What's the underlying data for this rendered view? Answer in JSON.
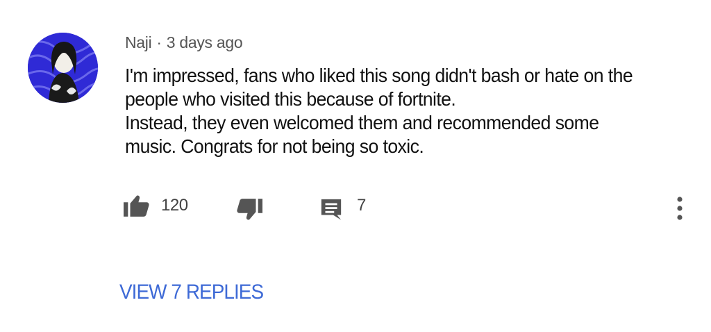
{
  "comment": {
    "author": "Naji",
    "separator": "·",
    "time": "3 days ago",
    "text_lines": [
      "I'm impressed, fans who liked this song didn't bash or hate on the",
      "people who visited this because of fortnite.",
      "Instead, they even welcomed them and recommended some",
      "music. Congrats for not being so toxic."
    ],
    "likes": "120",
    "replies_count": "7",
    "view_replies_label": "VIEW 7 REPLIES"
  },
  "icons": {
    "avatar": "user-avatar",
    "like": "thumbs-up-icon",
    "dislike": "thumbs-down-icon",
    "reply": "comment-icon",
    "more": "more-vertical-icon"
  },
  "colors": {
    "link": "#3e6ad6",
    "icon": "#555555",
    "avatar_bg": "#2f2ad6",
    "text": "#111111",
    "meta": "#555555"
  }
}
